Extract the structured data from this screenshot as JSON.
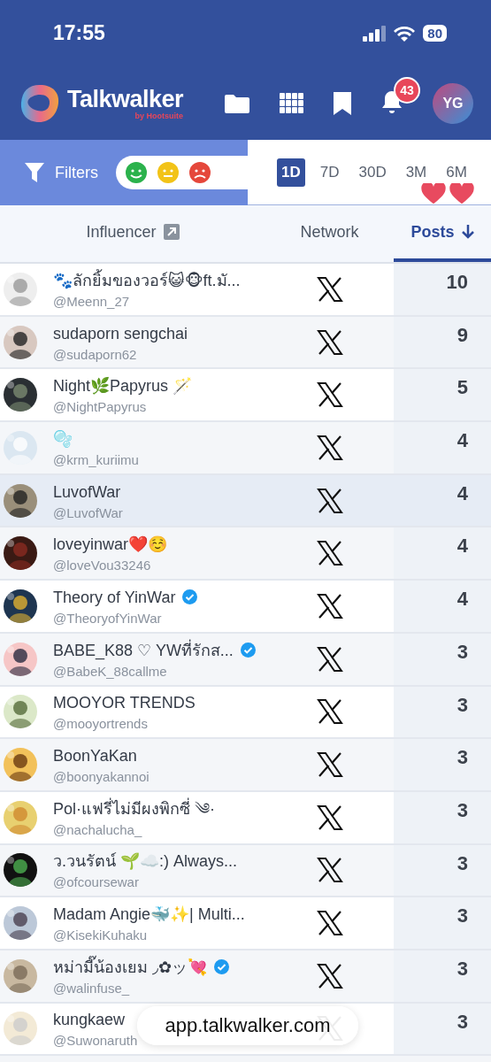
{
  "status_bar": {
    "time": "17:55",
    "battery": "80"
  },
  "header": {
    "logo": {
      "name": "Talkwalker",
      "tagline": "by Hootsuite"
    },
    "notifications": "43",
    "avatar": "YG"
  },
  "filters": {
    "label": "Filters",
    "ranges": [
      {
        "label": "1D",
        "selected": true
      },
      {
        "label": "7D",
        "selected": false
      },
      {
        "label": "30D",
        "selected": false
      },
      {
        "label": "3M",
        "selected": false
      },
      {
        "label": "6M",
        "selected": false
      }
    ]
  },
  "table": {
    "columns": [
      {
        "label": "Influencer",
        "sorted": false
      },
      {
        "label": "Network",
        "sorted": false
      },
      {
        "label": "Posts",
        "sorted": true
      }
    ],
    "rows": [
      {
        "name": "🐾ลักยิ้มของวอร์😺🐵ft.มั...",
        "handle": "@Meenn_27",
        "verified": false,
        "posts": "10",
        "selected": false
      },
      {
        "name": "sudaporn sengchai",
        "handle": "@sudaporn62",
        "verified": false,
        "posts": "9",
        "selected": false
      },
      {
        "name": "Night🌿Papyrus 🪄",
        "handle": "@NightPapyrus",
        "verified": false,
        "posts": "5",
        "selected": false
      },
      {
        "name": "🫧",
        "handle": "@krm_kuriimu",
        "verified": false,
        "posts": "4",
        "selected": false
      },
      {
        "name": "LuvofWar",
        "handle": "@LuvofWar",
        "verified": false,
        "posts": "4",
        "selected": true
      },
      {
        "name": "loveyinwar❤️☺️",
        "handle": "@loveVou33246",
        "verified": false,
        "posts": "4",
        "selected": false
      },
      {
        "name": "Theory of YinWar",
        "handle": "@TheoryofYinWar",
        "verified": true,
        "posts": "4",
        "selected": false
      },
      {
        "name": "BABE_K88 ♡ YWที่รักส...",
        "handle": "@BabeK_88callme",
        "verified": true,
        "posts": "3",
        "selected": false
      },
      {
        "name": "MOOYOR TRENDS",
        "handle": "@mooyortrends",
        "verified": false,
        "posts": "3",
        "selected": false
      },
      {
        "name": "BoonYaKan",
        "handle": "@boonyakannoi",
        "verified": false,
        "posts": "3",
        "selected": false
      },
      {
        "name": "Pol·แฟรี่ไม่มีผงพิกซี่ ༄·",
        "handle": "@nachalucha_",
        "verified": false,
        "posts": "3",
        "selected": false
      },
      {
        "name": "ว.วนรัตน์ 🌱☁️:) Always...",
        "handle": "@ofcoursewar",
        "verified": false,
        "posts": "3",
        "selected": false
      },
      {
        "name": "Madam Angie🐳✨| Multi...",
        "handle": "@KisekiKuhaku",
        "verified": false,
        "posts": "3",
        "selected": false
      },
      {
        "name": "หม่ามี๊น้องเยม ◞✿ッ💘",
        "handle": "@walinfuse_",
        "verified": true,
        "posts": "3",
        "selected": false
      },
      {
        "name": "kungkaew",
        "handle": "@Suwonaruth",
        "verified": false,
        "posts": "3",
        "selected": false
      }
    ]
  },
  "url_bar": {
    "url": "app.talkwalker.com"
  }
}
